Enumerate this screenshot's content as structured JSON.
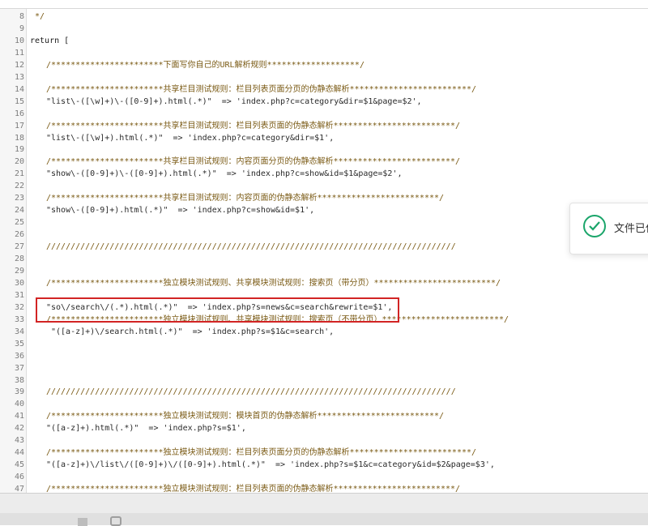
{
  "top_note": "",
  "editor": {
    "lines": [
      {
        "n": "8",
        "text": " */",
        "kind": "cmt",
        "indent": 0
      },
      {
        "n": "9",
        "text": "",
        "kind": "str",
        "indent": 0
      },
      {
        "n": "10",
        "text": "return [",
        "kind": "kw",
        "indent": 0
      },
      {
        "n": "11",
        "text": "",
        "kind": "str",
        "indent": 0
      },
      {
        "n": "12",
        "text": "/***********************下面写你自己的URL解析规则*******************/",
        "kind": "cmt",
        "indent": 1
      },
      {
        "n": "13",
        "text": "",
        "kind": "str",
        "indent": 0
      },
      {
        "n": "14",
        "text": "/***********************共享栏目测试规则：栏目列表页面分页的伪静态解析*************************/",
        "kind": "cmt",
        "indent": 1
      },
      {
        "n": "15",
        "text": "\"list\\-([\\w]+)\\-([0-9]+).html(.*)\"  => 'index.php?c=category&dir=$1&page=$2',",
        "kind": "str",
        "indent": 1
      },
      {
        "n": "16",
        "text": "",
        "kind": "str",
        "indent": 0
      },
      {
        "n": "17",
        "text": "/***********************共享栏目测试规则：栏目列表页面的伪静态解析*************************/",
        "kind": "cmt",
        "indent": 1
      },
      {
        "n": "18",
        "text": "\"list\\-([\\w]+).html(.*)\"  => 'index.php?c=category&dir=$1',",
        "kind": "str",
        "indent": 1
      },
      {
        "n": "19",
        "text": "",
        "kind": "str",
        "indent": 0
      },
      {
        "n": "20",
        "text": "/***********************共享栏目测试规则：内容页面分页的伪静态解析*************************/",
        "kind": "cmt",
        "indent": 1
      },
      {
        "n": "21",
        "text": "\"show\\-([0-9]+)\\-([0-9]+).html(.*)\"  => 'index.php?c=show&id=$1&page=$2',",
        "kind": "str",
        "indent": 1
      },
      {
        "n": "22",
        "text": "",
        "kind": "str",
        "indent": 0
      },
      {
        "n": "23",
        "text": "/***********************共享栏目测试规则：内容页面的伪静态解析*************************/",
        "kind": "cmt",
        "indent": 1
      },
      {
        "n": "24",
        "text": "\"show\\-([0-9]+).html(.*)\"  => 'index.php?c=show&id=$1',",
        "kind": "str",
        "indent": 1
      },
      {
        "n": "25",
        "text": "",
        "kind": "str",
        "indent": 0
      },
      {
        "n": "26",
        "text": "",
        "kind": "str",
        "indent": 0
      },
      {
        "n": "27",
        "text": "////////////////////////////////////////////////////////////////////////////////////",
        "kind": "cmt",
        "indent": 1
      },
      {
        "n": "28",
        "text": "",
        "kind": "str",
        "indent": 0
      },
      {
        "n": "29",
        "text": "",
        "kind": "str",
        "indent": 0
      },
      {
        "n": "30",
        "text": "/***********************独立模块测试规则、共享模块测试规则：搜索页（带分页）*************************/",
        "kind": "cmt",
        "indent": 1
      },
      {
        "n": "31",
        "text": "",
        "kind": "str",
        "indent": 0
      },
      {
        "n": "32",
        "text": "\"so\\/search\\/(.*).html(.*)\"  => 'index.php?s=news&c=search&rewrite=$1',",
        "kind": "str",
        "indent": 1
      },
      {
        "n": "33",
        "text": "/***********************独立模块测试规则、共享模块测试规则：搜索页（不带分页）*************************/",
        "kind": "cmt",
        "indent": 1
      },
      {
        "n": "34",
        "text": "\"([a-z]+)\\/search.html(.*)\"  => 'index.php?s=$1&c=search',",
        "kind": "str",
        "indent": 2
      },
      {
        "n": "35",
        "text": "",
        "kind": "str",
        "indent": 0
      },
      {
        "n": "36",
        "text": "",
        "kind": "str",
        "indent": 0
      },
      {
        "n": "37",
        "text": "",
        "kind": "str",
        "indent": 0
      },
      {
        "n": "38",
        "text": "",
        "kind": "str",
        "indent": 0
      },
      {
        "n": "39",
        "text": "////////////////////////////////////////////////////////////////////////////////////",
        "kind": "cmt",
        "indent": 1
      },
      {
        "n": "40",
        "text": "",
        "kind": "str",
        "indent": 0
      },
      {
        "n": "41",
        "text": "/***********************独立模块测试规则：模块首页的伪静态解析*************************/",
        "kind": "cmt",
        "indent": 1
      },
      {
        "n": "42",
        "text": "\"([a-z]+).html(.*)\"  => 'index.php?s=$1',",
        "kind": "str",
        "indent": 1
      },
      {
        "n": "43",
        "text": "",
        "kind": "str",
        "indent": 0
      },
      {
        "n": "44",
        "text": "/***********************独立模块测试规则：栏目列表页面分页的伪静态解析*************************/",
        "kind": "cmt",
        "indent": 1
      },
      {
        "n": "45",
        "text": "\"([a-z]+)\\/list\\/([0-9]+)\\/([0-9]+).html(.*)\"  => 'index.php?s=$1&c=category&id=$2&page=$3',",
        "kind": "str",
        "indent": 1
      },
      {
        "n": "46",
        "text": "",
        "kind": "str",
        "indent": 0
      },
      {
        "n": "47",
        "text": "/***********************独立模块测试规则：栏目列表页面的伪静态解析*************************/",
        "kind": "cmt",
        "indent": 1
      }
    ]
  },
  "toast": {
    "text": "文件已保",
    "icon": "check-circle-icon",
    "color": "#1aa56a"
  },
  "highlight_color": "#d22424"
}
